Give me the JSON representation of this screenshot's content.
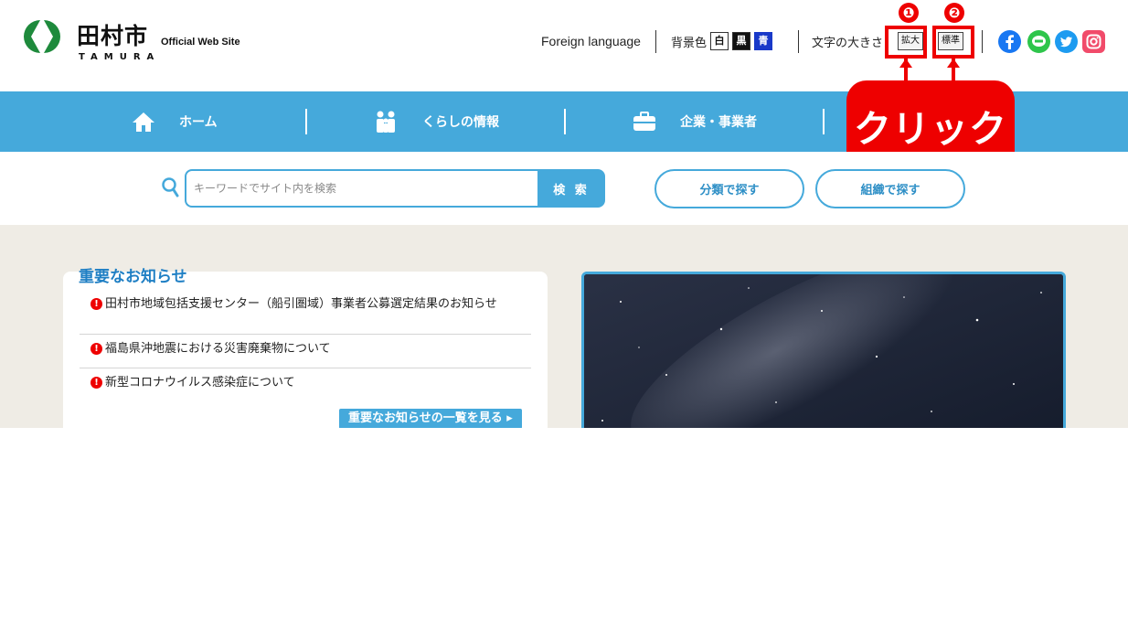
{
  "header": {
    "logo_name": "田村市",
    "logo_roman": "TAMURA",
    "logo_official": "Official Web Site",
    "foreign_language": "Foreign language",
    "bg_color_label": "背景色",
    "bg_options": [
      "白",
      "黒",
      "青"
    ],
    "text_size_label": "文字の大きさ",
    "size_big": "拡大",
    "size_standard": "標準"
  },
  "annotation": {
    "marker_1": "❶",
    "marker_2": "❷",
    "callout": "クリック",
    "color": "#ee0000"
  },
  "nav": {
    "home": "ホーム",
    "life": "くらしの情報",
    "business": "企業・事業者"
  },
  "search": {
    "placeholder": "キーワードでサイト内を検索",
    "button": "検 索",
    "by_category": "分類で探す",
    "by_organization": "組織で探す"
  },
  "notices": {
    "title": "重要なお知らせ",
    "items": [
      "田村市地域包括支援センター（船引圏域）事業者公募選定結果のお知らせ",
      "福島県沖地震における災害廃棄物について",
      "新型コロナウイルス感染症について"
    ],
    "more": "重要なお知らせの一覧を見る ▸"
  },
  "colors": {
    "brand_blue": "#45a9db",
    "logo_green": "#1e8a3c",
    "alert_red": "#ee0000"
  }
}
